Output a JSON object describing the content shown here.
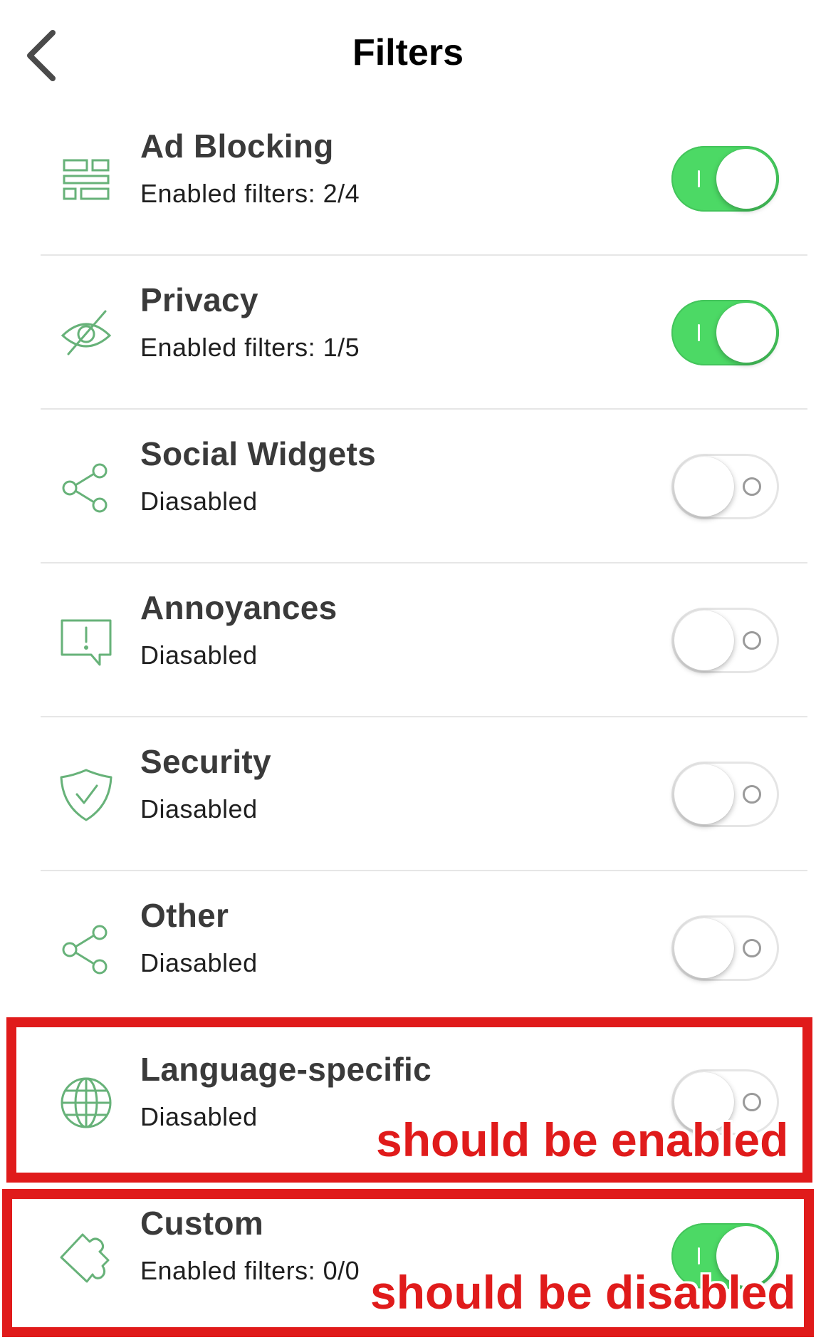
{
  "header": {
    "title": "Filters"
  },
  "filters": [
    {
      "name": "Ad Blocking",
      "status": "Enabled filters: 2/4",
      "enabled": true,
      "icon": "ad-blocking-icon"
    },
    {
      "name": "Privacy",
      "status": "Enabled filters: 1/5",
      "enabled": true,
      "icon": "eye-slash-icon"
    },
    {
      "name": "Social Widgets",
      "status": "Diasabled",
      "enabled": false,
      "icon": "share-icon"
    },
    {
      "name": "Annoyances",
      "status": "Diasabled",
      "enabled": false,
      "icon": "alert-message-icon"
    },
    {
      "name": "Security",
      "status": "Diasabled",
      "enabled": false,
      "icon": "shield-check-icon"
    },
    {
      "name": "Other",
      "status": "Diasabled",
      "enabled": false,
      "icon": "share-icon"
    },
    {
      "name": "Language-specific",
      "status": "Diasabled",
      "enabled": false,
      "icon": "globe-icon"
    },
    {
      "name": "Custom",
      "status": "Enabled filters: 0/0",
      "enabled": true,
      "icon": "puzzle-icon"
    }
  ],
  "annotations": [
    {
      "text": "should be enabled"
    },
    {
      "text": "should be disabled"
    }
  ],
  "colors": {
    "toggle_on": "#4cd965",
    "icon_green": "#67b279",
    "annotation_red": "#e01b1b"
  }
}
